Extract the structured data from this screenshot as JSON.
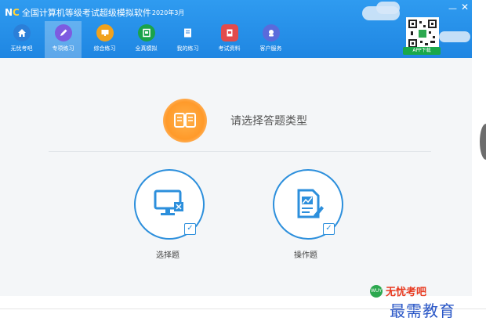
{
  "window": {
    "logo_n": "N",
    "logo_c": "C",
    "title": "全国计算机等级考试超级模拟软件",
    "title_date": "2020年3月",
    "minimize_label": "—",
    "close_label": "✕"
  },
  "nav": [
    {
      "label": "无忧考吧",
      "icon": "home-icon",
      "color": "#2b7fd8"
    },
    {
      "label": "专项练习",
      "icon": "pencil-icon",
      "color": "#7d5be0"
    },
    {
      "label": "综合练习",
      "icon": "monitor-icon",
      "color": "#f0a21d"
    },
    {
      "label": "全真模拟",
      "icon": "exam-icon",
      "color": "#1aa34a"
    },
    {
      "label": "我的练习",
      "icon": "notes-icon",
      "color": "#2b7fd8"
    },
    {
      "label": "考试资料",
      "icon": "document-icon",
      "color": "#e24b4b"
    },
    {
      "label": "客户服务",
      "icon": "service-icon",
      "color": "#5a6bdb"
    }
  ],
  "app_download": "APP下载",
  "prompt": "请选择答题类型",
  "choices": [
    {
      "label": "选择题"
    },
    {
      "label": "操作题"
    }
  ],
  "brand": {
    "icon_text": "WUY",
    "name": "无忧考吧"
  },
  "watermark": "最需教育",
  "colors": {
    "accent": "#2c8fdc",
    "topbar": "#2f9bf0",
    "orange": "#ff9a2a",
    "brand_red": "#e8391f"
  }
}
